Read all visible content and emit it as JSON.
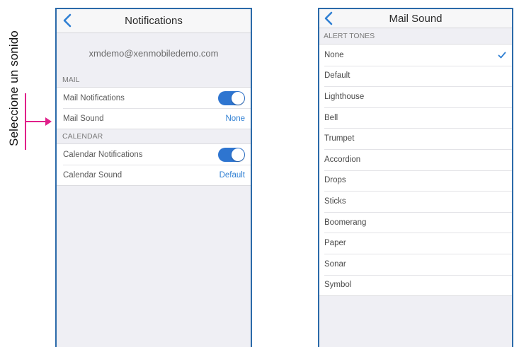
{
  "annotation": {
    "label": "Seleccione un sonido",
    "accent_color": "#e0208a"
  },
  "notifications_screen": {
    "title": "Notifications",
    "back_icon": "chevron-left-icon",
    "account_email": "xmdemo@xenmobiledemo.com",
    "mail_section": {
      "header": "MAIL",
      "notifications_label": "Mail Notifications",
      "notifications_enabled": true,
      "sound_label": "Mail Sound",
      "sound_value": "None"
    },
    "calendar_section": {
      "header": "CALENDAR",
      "notifications_label": "Calendar Notifications",
      "notifications_enabled": true,
      "sound_label": "Calendar Sound",
      "sound_value": "Default"
    }
  },
  "mail_sound_screen": {
    "title": "Mail Sound",
    "back_icon": "chevron-left-icon",
    "section_header": "ALERT TONES",
    "tones": [
      "None",
      "Default",
      "Lighthouse",
      "Bell",
      "Trumpet",
      "Accordion",
      "Drops",
      "Sticks",
      "Boomerang",
      "Paper",
      "Sonar",
      "Symbol"
    ],
    "selected": "None",
    "check_icon": "checkmark-icon"
  },
  "colors": {
    "frame": "#2b6aa9",
    "accent_blue": "#2f7fd3",
    "toggle_on": "#2e75d0",
    "background": "#efeff4"
  }
}
